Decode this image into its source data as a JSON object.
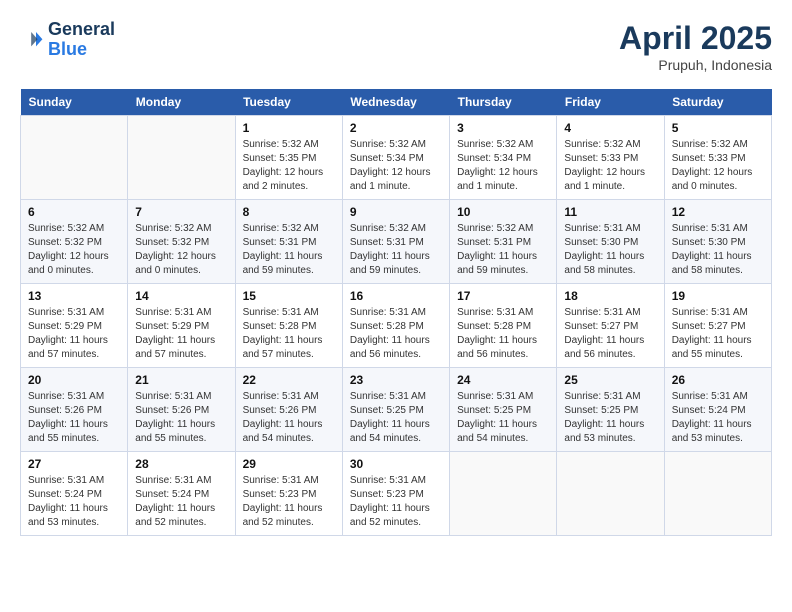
{
  "header": {
    "logo_line1": "General",
    "logo_line2": "Blue",
    "month_title": "April 2025",
    "location": "Prupuh, Indonesia"
  },
  "weekdays": [
    "Sunday",
    "Monday",
    "Tuesday",
    "Wednesday",
    "Thursday",
    "Friday",
    "Saturday"
  ],
  "weeks": [
    [
      {
        "day": "",
        "info": ""
      },
      {
        "day": "",
        "info": ""
      },
      {
        "day": "1",
        "info": "Sunrise: 5:32 AM\nSunset: 5:35 PM\nDaylight: 12 hours\nand 2 minutes."
      },
      {
        "day": "2",
        "info": "Sunrise: 5:32 AM\nSunset: 5:34 PM\nDaylight: 12 hours\nand 1 minute."
      },
      {
        "day": "3",
        "info": "Sunrise: 5:32 AM\nSunset: 5:34 PM\nDaylight: 12 hours\nand 1 minute."
      },
      {
        "day": "4",
        "info": "Sunrise: 5:32 AM\nSunset: 5:33 PM\nDaylight: 12 hours\nand 1 minute."
      },
      {
        "day": "5",
        "info": "Sunrise: 5:32 AM\nSunset: 5:33 PM\nDaylight: 12 hours\nand 0 minutes."
      }
    ],
    [
      {
        "day": "6",
        "info": "Sunrise: 5:32 AM\nSunset: 5:32 PM\nDaylight: 12 hours\nand 0 minutes."
      },
      {
        "day": "7",
        "info": "Sunrise: 5:32 AM\nSunset: 5:32 PM\nDaylight: 12 hours\nand 0 minutes."
      },
      {
        "day": "8",
        "info": "Sunrise: 5:32 AM\nSunset: 5:31 PM\nDaylight: 11 hours\nand 59 minutes."
      },
      {
        "day": "9",
        "info": "Sunrise: 5:32 AM\nSunset: 5:31 PM\nDaylight: 11 hours\nand 59 minutes."
      },
      {
        "day": "10",
        "info": "Sunrise: 5:32 AM\nSunset: 5:31 PM\nDaylight: 11 hours\nand 59 minutes."
      },
      {
        "day": "11",
        "info": "Sunrise: 5:31 AM\nSunset: 5:30 PM\nDaylight: 11 hours\nand 58 minutes."
      },
      {
        "day": "12",
        "info": "Sunrise: 5:31 AM\nSunset: 5:30 PM\nDaylight: 11 hours\nand 58 minutes."
      }
    ],
    [
      {
        "day": "13",
        "info": "Sunrise: 5:31 AM\nSunset: 5:29 PM\nDaylight: 11 hours\nand 57 minutes."
      },
      {
        "day": "14",
        "info": "Sunrise: 5:31 AM\nSunset: 5:29 PM\nDaylight: 11 hours\nand 57 minutes."
      },
      {
        "day": "15",
        "info": "Sunrise: 5:31 AM\nSunset: 5:28 PM\nDaylight: 11 hours\nand 57 minutes."
      },
      {
        "day": "16",
        "info": "Sunrise: 5:31 AM\nSunset: 5:28 PM\nDaylight: 11 hours\nand 56 minutes."
      },
      {
        "day": "17",
        "info": "Sunrise: 5:31 AM\nSunset: 5:28 PM\nDaylight: 11 hours\nand 56 minutes."
      },
      {
        "day": "18",
        "info": "Sunrise: 5:31 AM\nSunset: 5:27 PM\nDaylight: 11 hours\nand 56 minutes."
      },
      {
        "day": "19",
        "info": "Sunrise: 5:31 AM\nSunset: 5:27 PM\nDaylight: 11 hours\nand 55 minutes."
      }
    ],
    [
      {
        "day": "20",
        "info": "Sunrise: 5:31 AM\nSunset: 5:26 PM\nDaylight: 11 hours\nand 55 minutes."
      },
      {
        "day": "21",
        "info": "Sunrise: 5:31 AM\nSunset: 5:26 PM\nDaylight: 11 hours\nand 55 minutes."
      },
      {
        "day": "22",
        "info": "Sunrise: 5:31 AM\nSunset: 5:26 PM\nDaylight: 11 hours\nand 54 minutes."
      },
      {
        "day": "23",
        "info": "Sunrise: 5:31 AM\nSunset: 5:25 PM\nDaylight: 11 hours\nand 54 minutes."
      },
      {
        "day": "24",
        "info": "Sunrise: 5:31 AM\nSunset: 5:25 PM\nDaylight: 11 hours\nand 54 minutes."
      },
      {
        "day": "25",
        "info": "Sunrise: 5:31 AM\nSunset: 5:25 PM\nDaylight: 11 hours\nand 53 minutes."
      },
      {
        "day": "26",
        "info": "Sunrise: 5:31 AM\nSunset: 5:24 PM\nDaylight: 11 hours\nand 53 minutes."
      }
    ],
    [
      {
        "day": "27",
        "info": "Sunrise: 5:31 AM\nSunset: 5:24 PM\nDaylight: 11 hours\nand 53 minutes."
      },
      {
        "day": "28",
        "info": "Sunrise: 5:31 AM\nSunset: 5:24 PM\nDaylight: 11 hours\nand 52 minutes."
      },
      {
        "day": "29",
        "info": "Sunrise: 5:31 AM\nSunset: 5:23 PM\nDaylight: 11 hours\nand 52 minutes."
      },
      {
        "day": "30",
        "info": "Sunrise: 5:31 AM\nSunset: 5:23 PM\nDaylight: 11 hours\nand 52 minutes."
      },
      {
        "day": "",
        "info": ""
      },
      {
        "day": "",
        "info": ""
      },
      {
        "day": "",
        "info": ""
      }
    ]
  ]
}
